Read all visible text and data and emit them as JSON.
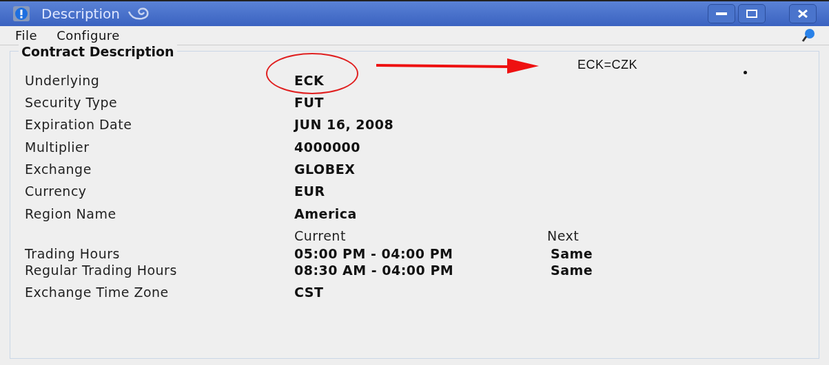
{
  "window": {
    "title": "Description"
  },
  "menu": [
    "File",
    "Configure"
  ],
  "group": {
    "title": "Contract Description"
  },
  "fields": [
    {
      "label": "Underlying",
      "value": "ECK",
      "circled": true
    },
    {
      "label": "Security Type",
      "value": "FUT",
      "circled": false
    },
    {
      "label": "Expiration Date",
      "value": "JUN 16, 2008",
      "circled": false
    },
    {
      "label": "Multiplier",
      "value": "4000000",
      "circled": false
    },
    {
      "label": "Exchange",
      "value": "GLOBEX",
      "circled": false
    },
    {
      "label": "Currency",
      "value": "EUR",
      "circled": false
    },
    {
      "label": "Region Name",
      "value": "America",
      "circled": false
    }
  ],
  "hours": {
    "columns": [
      "Current",
      "Next"
    ],
    "rows": [
      {
        "label": "Trading Hours",
        "current": "05:00 PM - 04:00 PM",
        "next": "Same"
      },
      {
        "label": "Regular Trading Hours",
        "current": "08:30 AM - 04:00 PM",
        "next": "Same"
      }
    ]
  },
  "time_zone": {
    "label": "Exchange Time Zone",
    "value": "CST"
  },
  "annotation": {
    "text": "ECK=CZK"
  }
}
